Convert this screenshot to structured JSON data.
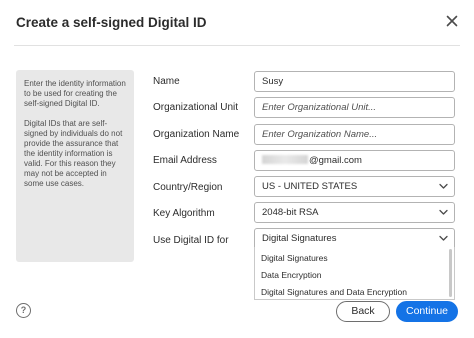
{
  "dialog": {
    "title": "Create a self-signed Digital ID",
    "close_icon": "close-icon"
  },
  "info": {
    "paragraph1": "Enter the identity information to be used for creating the self-signed Digital ID.",
    "paragraph2": "Digital IDs that are self-signed by individuals do not provide the assurance that the identity information is valid. For this reason they may not be accepted in some use cases."
  },
  "form": {
    "name": {
      "label": "Name",
      "value": "Susy"
    },
    "org_unit": {
      "label": "Organizational Unit",
      "placeholder": "Enter Organizational Unit..."
    },
    "org_name": {
      "label": "Organization Name",
      "placeholder": "Enter Organization Name..."
    },
    "email": {
      "label": "Email Address",
      "value": "@gmail.com"
    },
    "country": {
      "label": "Country/Region",
      "value": "US - UNITED STATES"
    },
    "key_algorithm": {
      "label": "Key Algorithm",
      "value": "2048-bit RSA"
    },
    "use_for": {
      "label": "Use Digital ID for",
      "value": "Digital Signatures",
      "options": [
        "Digital Signatures",
        "Data Encryption",
        "Digital Signatures and Data Encryption"
      ]
    }
  },
  "footer": {
    "help_label": "?",
    "back_label": "Back",
    "continue_label": "Continue"
  },
  "colors": {
    "accent": "#1473e6",
    "panel_bg": "#e8e8e8"
  }
}
